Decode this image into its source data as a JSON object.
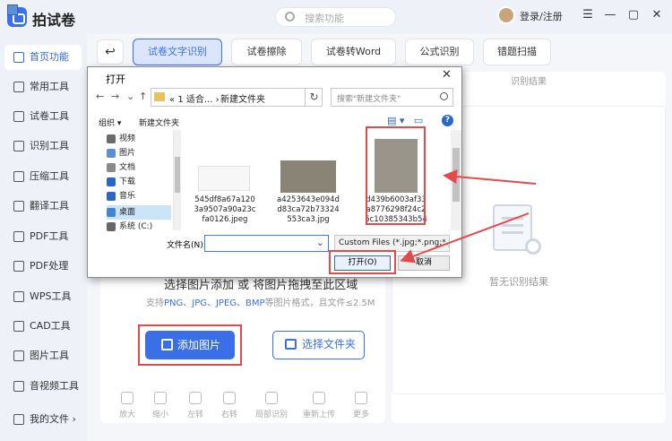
{
  "app": {
    "name": "拍试卷",
    "search_placeholder": "搜索功能",
    "login": "登录/注册",
    "win_buttons": [
      "☰",
      "—",
      "▢",
      "✕"
    ]
  },
  "sidebar": {
    "items": [
      {
        "label": "首页功能",
        "icon": "home-icon",
        "active": true
      },
      {
        "label": "常用工具",
        "icon": "layers-icon"
      },
      {
        "label": "试卷工具",
        "icon": "paper-icon"
      },
      {
        "label": "识别工具",
        "icon": "scan-icon"
      },
      {
        "label": "压缩工具",
        "icon": "compress-icon"
      },
      {
        "label": "翻译工具",
        "icon": "translate-icon"
      },
      {
        "label": "PDF工具",
        "icon": "pdf-icon"
      },
      {
        "label": "PDF处理",
        "icon": "pdf-process-icon"
      },
      {
        "label": "WPS工具",
        "icon": "wps-icon"
      },
      {
        "label": "CAD工具",
        "icon": "cad-icon"
      },
      {
        "label": "图片工具",
        "icon": "image-icon"
      },
      {
        "label": "音视频工具",
        "icon": "media-icon"
      }
    ],
    "my_files": "我的文件"
  },
  "tabs": [
    "试卷文字识别",
    "试卷擦除",
    "试卷转Word",
    "公式识别",
    "错题扫描"
  ],
  "result": {
    "header": "识别结果",
    "empty": "暂无识别结果"
  },
  "upload": {
    "title": "选择图片添加 或 将图片拖拽至此区域",
    "hint_prefix": "支持",
    "hint_formats": "PNG、JPG、JPEG、BMP",
    "hint_suffix": "等图片格式，且文件≤2.5M",
    "add_button": "添加图片",
    "folder_button": "选择文件夹"
  },
  "tools": [
    "放大",
    "缩小",
    "左转",
    "右转",
    "局部识别",
    "重新上传",
    "更多"
  ],
  "dialog": {
    "title": "打开",
    "path": [
      "1 适合...",
      "新建文件夹"
    ],
    "path_prefix": "«",
    "search_placeholder": "搜索\"新建文件夹\"",
    "organize": "组织 ▾",
    "new_folder": "新建文件夹",
    "tree": [
      {
        "label": "视频",
        "color": "#6b6b6b"
      },
      {
        "label": "图片",
        "color": "#5b8fd8"
      },
      {
        "label": "文档",
        "color": "#8a8a8a"
      },
      {
        "label": "下载",
        "color": "#2a67c9"
      },
      {
        "label": "音乐",
        "color": "#2a67c9"
      },
      {
        "label": "桌面",
        "color": "#3f86d8",
        "selected": true
      },
      {
        "label": "系统 (C:)",
        "color": "#666"
      }
    ],
    "files": [
      {
        "name": "545df8a67a120\n3a9507a90a23c\nfa0126.jpeg"
      },
      {
        "name": "a4253643e094d\nd83ca72b73324\n553ca3.jpg"
      },
      {
        "name": "d439b6003af33\na8776298f24c2\n5c10385343b54"
      }
    ],
    "filename_label": "文件名(N):",
    "filetype": "Custom Files (*.jpg;*.png;*.jp",
    "open_button": "打开(O)",
    "cancel_button": "取消"
  }
}
